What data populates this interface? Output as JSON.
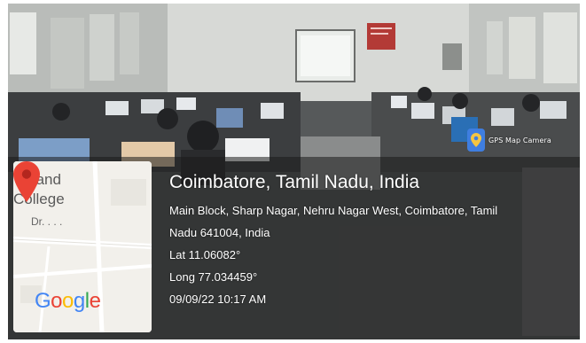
{
  "badge": {
    "label": "GPS Map Camera",
    "icon": "map-pin-icon"
  },
  "map": {
    "text_line1": "rts and",
    "text_line2": "College",
    "text_line3": "Dr. . . .",
    "brand": "Google",
    "brand_letters": [
      "G",
      "o",
      "o",
      "g",
      "l",
      "e"
    ],
    "brand_colors": [
      "#4285F4",
      "#EA4335",
      "#FBBC05",
      "#4285F4",
      "#34A853",
      "#EA4335"
    ],
    "pin_color": "#EA4335"
  },
  "location": {
    "title": "Coimbatore, Tamil Nadu, India",
    "address_line1": "Main Block, Sharp Nagar, Nehru Nagar West, Coimbatore, Tamil",
    "address_line2": "Nadu 641004, India",
    "lat": "Lat 11.06082°",
    "long": "Long 77.034459°",
    "datetime": "09/09/22 10:17 AM"
  }
}
